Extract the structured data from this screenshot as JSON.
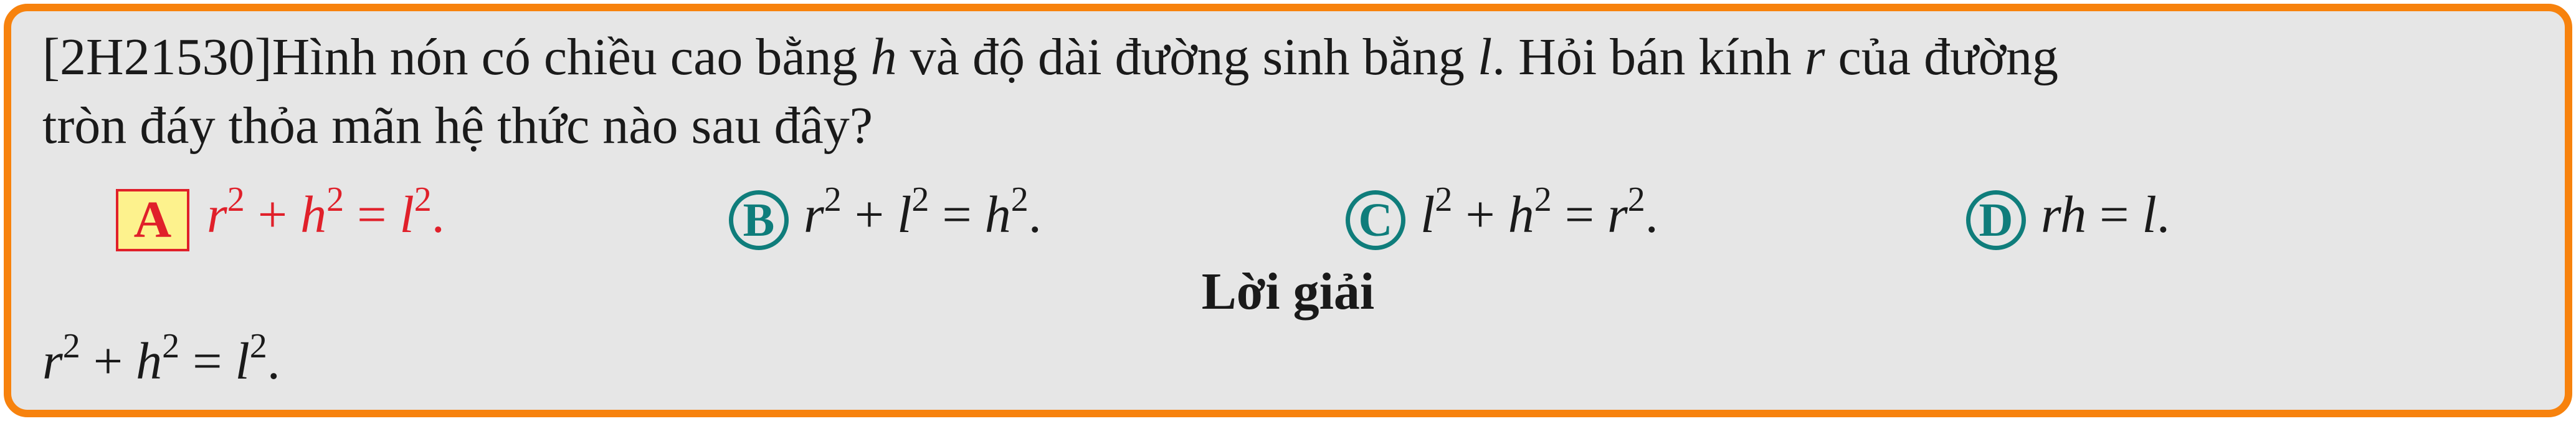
{
  "question": {
    "line1_prefix": "[2H21530]Hình nón có chiều cao bằng ",
    "var_h": "h",
    "line1_mid1": " và độ dài đường sinh bằng ",
    "var_l": "l",
    "line1_mid2": ". Hỏi bán kính ",
    "var_r": "r",
    "line1_suffix": " của đường",
    "line2": "tròn đáy thỏa mãn hệ thức nào sau đây?"
  },
  "options": [
    {
      "label": "A",
      "b1": "r",
      "e1": "2",
      "op1": " + ",
      "b2": "h",
      "e2": "2",
      "eq": " = ",
      "b3": "l",
      "e3": "2",
      "end": ".",
      "correct": true
    },
    {
      "label": "B",
      "b1": "r",
      "e1": "2",
      "op1": " + ",
      "b2": "l",
      "e2": "2",
      "eq": " = ",
      "b3": "h",
      "e3": "2",
      "end": ".",
      "correct": false
    },
    {
      "label": "C",
      "b1": "l",
      "e1": "2",
      "op1": " + ",
      "b2": "h",
      "e2": "2",
      "eq": " = ",
      "b3": "r",
      "e3": "2",
      "end": ".",
      "correct": false
    },
    {
      "label": "D",
      "formula_lhs": "rh",
      "eq": " = ",
      "rhs": "l",
      "end": ".",
      "correct": false
    }
  ],
  "solution": {
    "title": "Lời giải",
    "b1": "r",
    "e1": "2",
    "op1": " + ",
    "b2": "h",
    "e2": "2",
    "eq": " = ",
    "b3": "l",
    "e3": "2",
    "end": "."
  },
  "colors": {
    "frame": "#f7820d",
    "background": "#e6e6e6",
    "correct": "#e0202a",
    "option_circle": "#0f7d7b",
    "answer_box_fill": "#fdf28d"
  }
}
